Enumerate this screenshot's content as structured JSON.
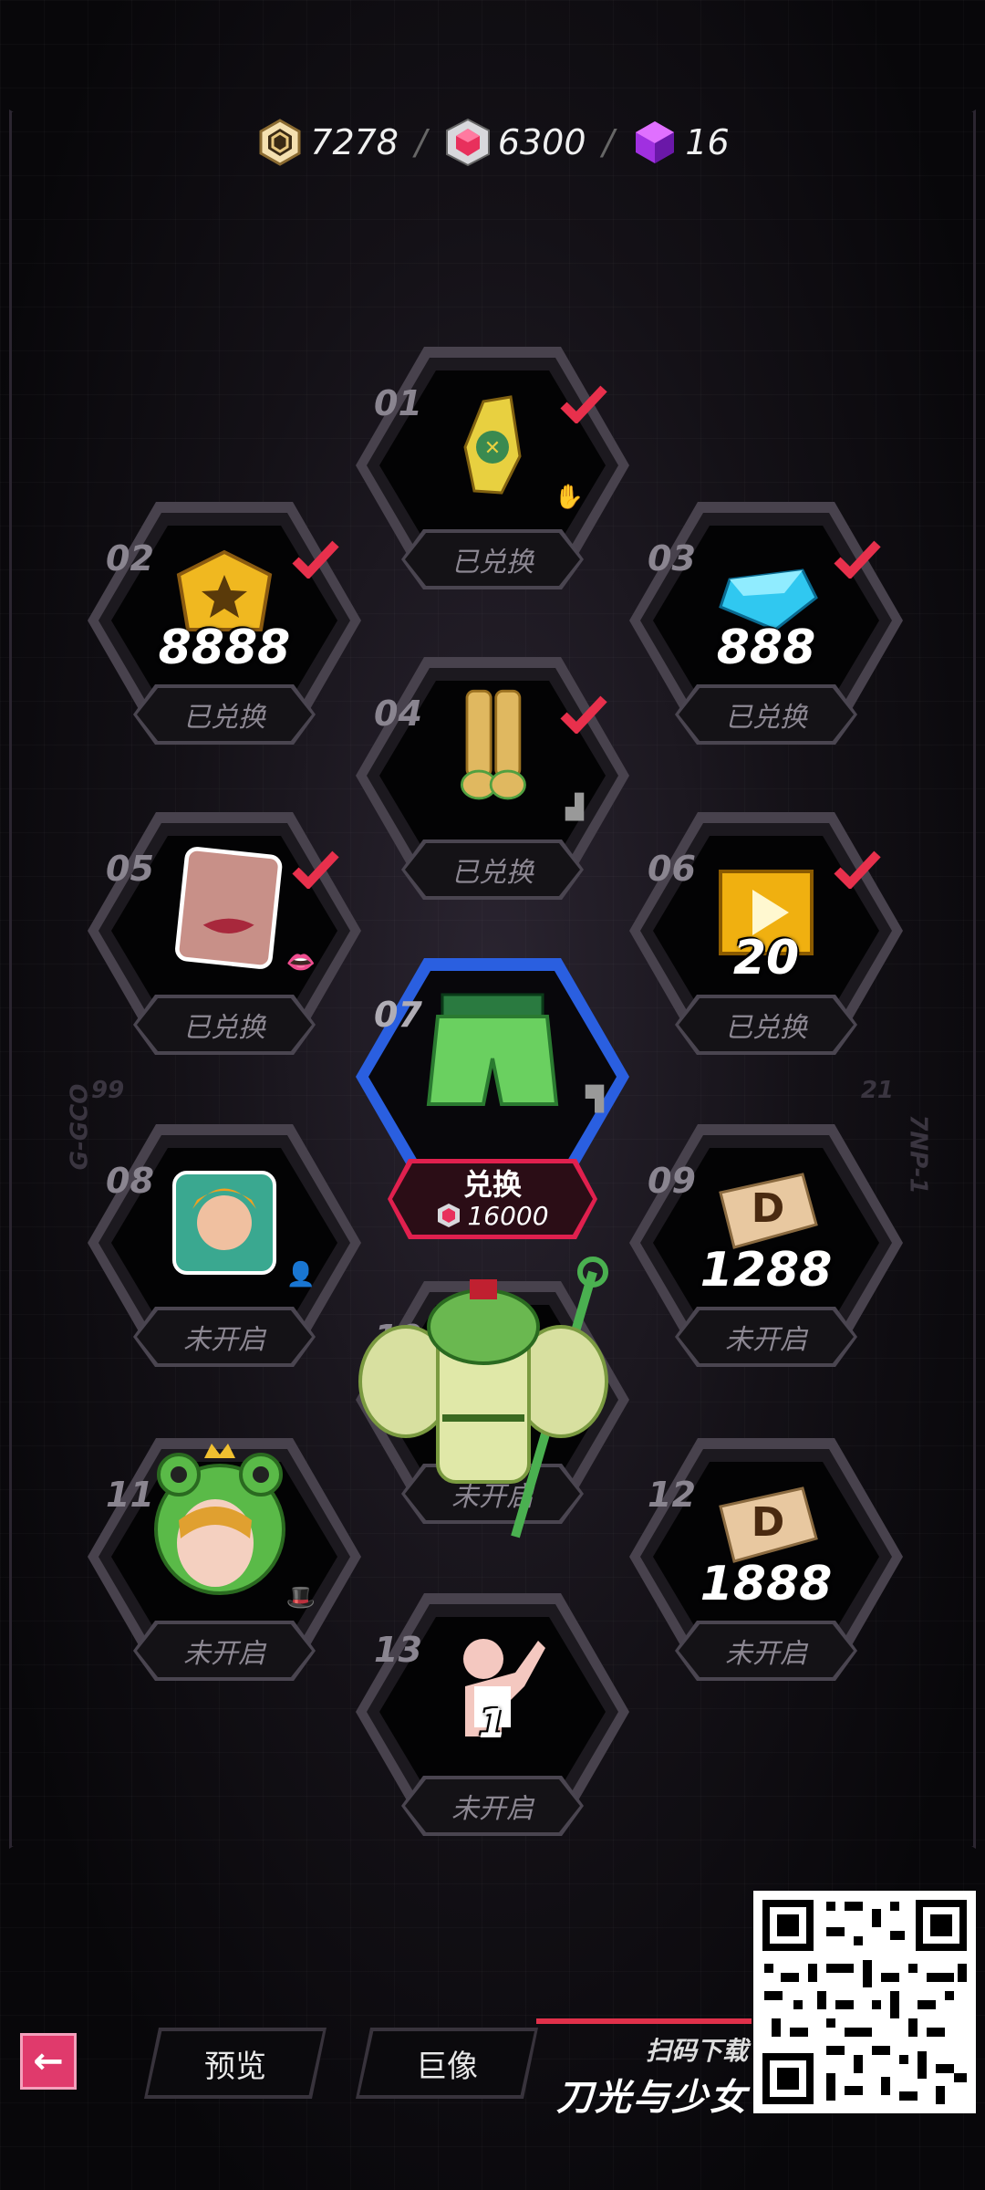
{
  "currency": {
    "items": [
      {
        "icon": "gold-medal-icon",
        "value": "7278"
      },
      {
        "icon": "red-crystal-icon",
        "value": "6300"
      },
      {
        "icon": "purple-cube-icon",
        "value": "16"
      }
    ],
    "separator": "/"
  },
  "slots": [
    {
      "num": "01",
      "status": "已兑换",
      "claimed": true,
      "item": "glove-icon"
    },
    {
      "num": "02",
      "status": "已兑换",
      "claimed": true,
      "item": "gold-coin-icon",
      "amount": "8888"
    },
    {
      "num": "03",
      "status": "已兑换",
      "claimed": true,
      "item": "blue-diamond-icon",
      "amount": "888"
    },
    {
      "num": "04",
      "status": "已兑换",
      "claimed": true,
      "item": "boots-icon"
    },
    {
      "num": "05",
      "status": "已兑换",
      "claimed": true,
      "item": "lips-icon"
    },
    {
      "num": "06",
      "status": "已兑换",
      "claimed": true,
      "item": "video-ticket-icon",
      "amount": "20"
    },
    {
      "num": "07",
      "item": "shorts-icon",
      "redeem_label": "兑换",
      "redeem_cost": "16000"
    },
    {
      "num": "08",
      "status": "未开启",
      "claimed": false,
      "item": "avatar-frame-icon"
    },
    {
      "num": "09",
      "status": "未开启",
      "claimed": false,
      "item": "d-voucher-icon",
      "amount": "1288"
    },
    {
      "num": "10",
      "status": "未开启",
      "claimed": false,
      "item": "frog-outfit-icon"
    },
    {
      "num": "11",
      "status": "未开启",
      "claimed": false,
      "item": "frog-hat-icon"
    },
    {
      "num": "12",
      "status": "未开启",
      "claimed": false,
      "item": "d-voucher-icon",
      "amount": "1888"
    },
    {
      "num": "13",
      "status": "未开启",
      "claimed": false,
      "item": "pose-icon",
      "amount": "1"
    }
  ],
  "side_labels": {
    "left": "G-GCO",
    "right": "7NP-1",
    "left_num": "99",
    "right_num": "21"
  },
  "bottom": {
    "back_label": "←",
    "tabs": [
      "预览",
      "巨像"
    ],
    "qr_caption": "扫码下载",
    "brand": "刀光与少女"
  },
  "colors": {
    "accent_pink": "#e03a6c",
    "active_blue": "#2a5fe0",
    "redeem_red": "#e0204e",
    "check_red": "#e8304c"
  }
}
